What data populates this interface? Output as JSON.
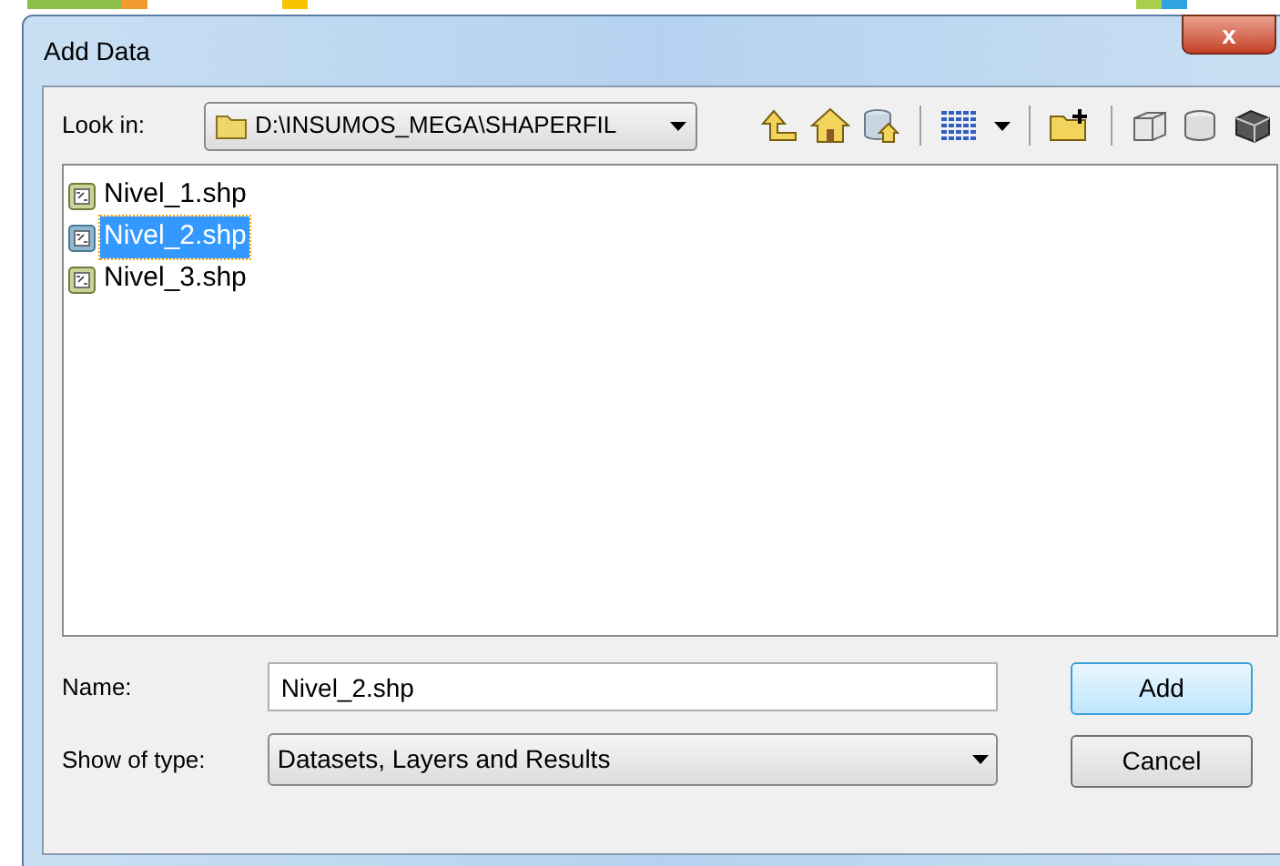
{
  "window": {
    "title": "Add Data",
    "close": "x"
  },
  "look_in": {
    "label": "Look in:",
    "value": "D:\\INSUMOS_MEGA\\SHAPERFIL"
  },
  "files": [
    {
      "name": "Nivel_1.shp",
      "selected": false
    },
    {
      "name": "Nivel_2.shp",
      "selected": true
    },
    {
      "name": "Nivel_3.shp",
      "selected": false
    }
  ],
  "name_field": {
    "label": "Name:",
    "value": "Nivel_2.shp"
  },
  "type_field": {
    "label": "Show of type:",
    "value": "Datasets, Layers and Results"
  },
  "buttons": [
    "Add",
    "Cancel"
  ]
}
